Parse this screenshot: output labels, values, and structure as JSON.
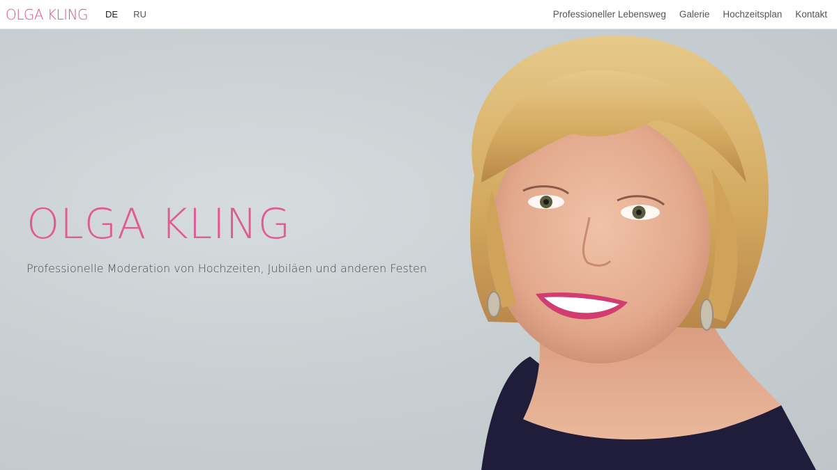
{
  "header": {
    "logo": "OLGA KLING",
    "languages": [
      "DE",
      "RU"
    ],
    "active_language": "DE",
    "nav": [
      "Professioneller Lebensweg",
      "Galerie",
      "Hochzeitsplan",
      "Kontakt"
    ]
  },
  "hero": {
    "title": "OLGA KLING",
    "subtitle": "Professionelle Moderation von Hochzeiten, Jubiläen und anderen Festen"
  },
  "colors": {
    "accent": "#e05a94",
    "hero_background": "#c9d0d3",
    "text": "#555555"
  }
}
